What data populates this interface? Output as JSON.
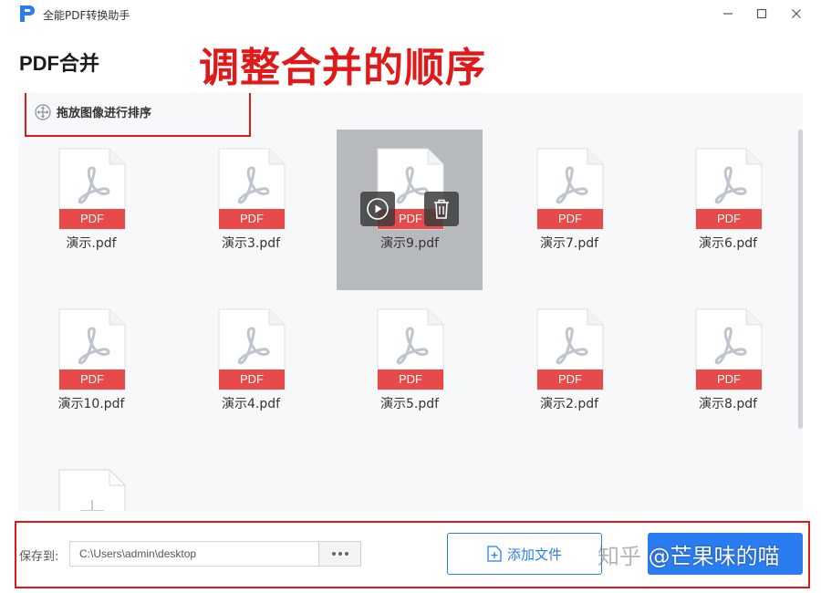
{
  "window": {
    "app_title": "全能PDF转换助手",
    "controls": [
      "minimize-icon",
      "maximize-icon",
      "close-icon"
    ]
  },
  "page_title": "PDF合并",
  "annotation": "调整合并的顺序",
  "drag_hint": "拖放图像进行排序",
  "file_badge": "PDF",
  "files": [
    {
      "name": "演示.pdf"
    },
    {
      "name": "演示3.pdf"
    },
    {
      "name": "演示9.pdf",
      "selected": true
    },
    {
      "name": "演示7.pdf"
    },
    {
      "name": "演示6.pdf"
    },
    {
      "name": "演示10.pdf"
    },
    {
      "name": "演示4.pdf"
    },
    {
      "name": "演示5.pdf"
    },
    {
      "name": "演示2.pdf"
    },
    {
      "name": "演示8.pdf"
    }
  ],
  "selected_file_actions": [
    "play-icon",
    "trash-icon"
  ],
  "bottom": {
    "save_label": "保存到:",
    "save_path": "C:\\Users\\admin\\desktop",
    "add_file_label": "添加文件"
  },
  "watermark": {
    "site": "知乎",
    "author": "@芒果味的喵"
  },
  "colors": {
    "accent": "#2b7cf0",
    "annotation_red": "#e01a1a",
    "pdf_badge": "#e84a4a",
    "selected_bg": "#b6babd"
  }
}
